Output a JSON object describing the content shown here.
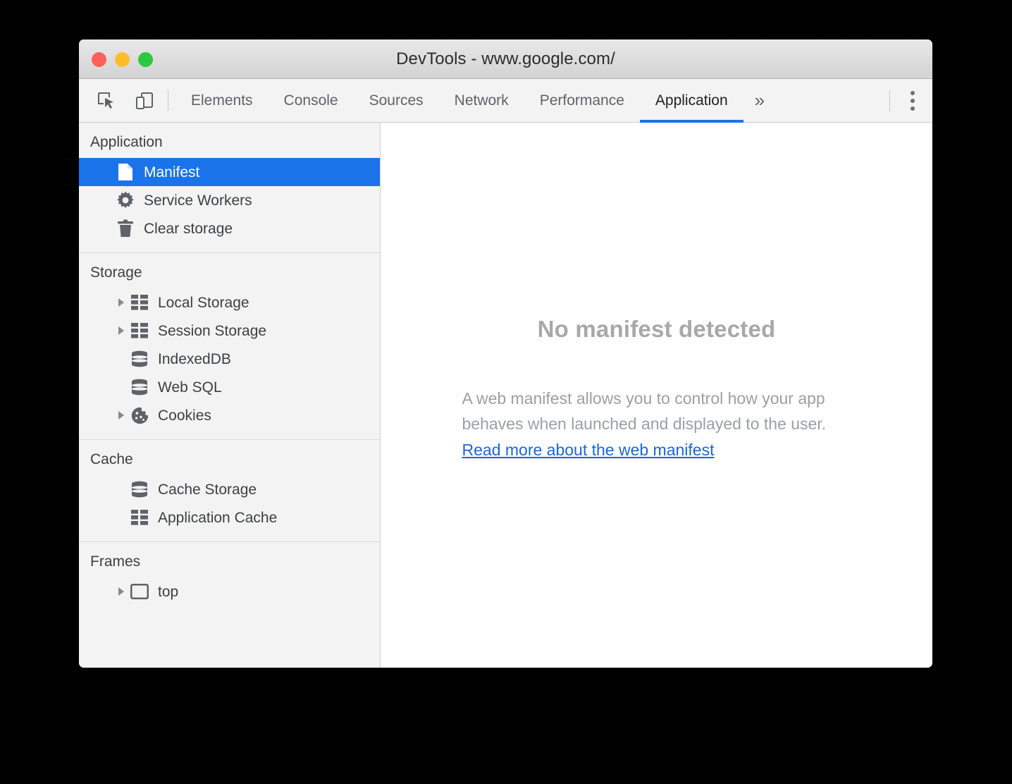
{
  "window": {
    "title": "DevTools - www.google.com/",
    "traffic_lights": [
      {
        "name": "close",
        "color": "#ff6159"
      },
      {
        "name": "minimize",
        "color": "#ffbd2e"
      },
      {
        "name": "maximize",
        "color": "#2bc840"
      }
    ]
  },
  "toolbar": {
    "inspect_icon": "inspect-element-icon",
    "device_icon": "device-toolbar-icon",
    "more_tabs_label": "»",
    "kebab_icon": "more-options-icon"
  },
  "tabs": [
    {
      "label": "Elements",
      "active": false
    },
    {
      "label": "Console",
      "active": false
    },
    {
      "label": "Sources",
      "active": false
    },
    {
      "label": "Network",
      "active": false
    },
    {
      "label": "Performance",
      "active": false
    },
    {
      "label": "Application",
      "active": true
    }
  ],
  "sidebar": {
    "sections": [
      {
        "title": "Application",
        "items": [
          {
            "label": "Manifest",
            "icon": "document-icon",
            "selected": true,
            "expandable": false
          },
          {
            "label": "Service Workers",
            "icon": "gear-icon",
            "selected": false,
            "expandable": false
          },
          {
            "label": "Clear storage",
            "icon": "trash-icon",
            "selected": false,
            "expandable": false
          }
        ]
      },
      {
        "title": "Storage",
        "items": [
          {
            "label": "Local Storage",
            "icon": "table-icon",
            "selected": false,
            "expandable": true
          },
          {
            "label": "Session Storage",
            "icon": "table-icon",
            "selected": false,
            "expandable": true
          },
          {
            "label": "IndexedDB",
            "icon": "database-icon",
            "selected": false,
            "expandable": false
          },
          {
            "label": "Web SQL",
            "icon": "database-icon",
            "selected": false,
            "expandable": false
          },
          {
            "label": "Cookies",
            "icon": "cookie-icon",
            "selected": false,
            "expandable": true
          }
        ]
      },
      {
        "title": "Cache",
        "items": [
          {
            "label": "Cache Storage",
            "icon": "database-icon",
            "selected": false,
            "expandable": false
          },
          {
            "label": "Application Cache",
            "icon": "table-icon",
            "selected": false,
            "expandable": false
          }
        ]
      },
      {
        "title": "Frames",
        "items": [
          {
            "label": "top",
            "icon": "frame-icon",
            "selected": false,
            "expandable": true
          }
        ]
      }
    ]
  },
  "main": {
    "empty_title": "No manifest detected",
    "empty_body": "A web manifest allows you to control how your app behaves when launched and displayed to the user.",
    "empty_link": "Read more about the web manifest"
  },
  "colors": {
    "accent": "#1a73e8",
    "sidebar_bg": "#f3f3f3",
    "muted_text": "#9aa0a6",
    "link": "#1a66d8"
  }
}
